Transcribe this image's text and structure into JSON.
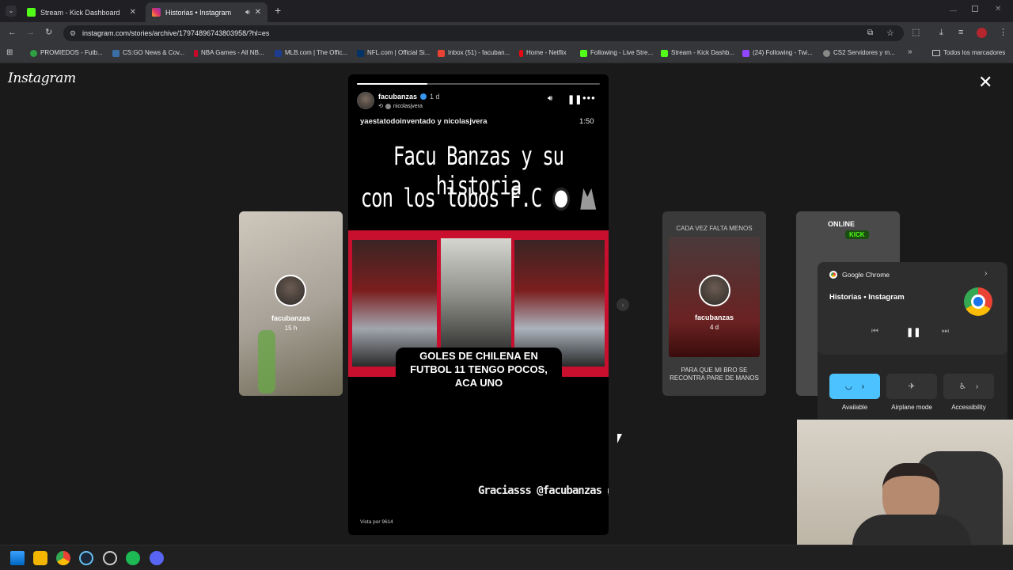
{
  "browser": {
    "tabs": [
      {
        "title": "Stream - Kick Dashboard",
        "favicon_color": "#53fc18"
      },
      {
        "title": "Historias • Instagram",
        "favicon_color": "#e1306c"
      }
    ],
    "url": "instagram.com/stories/archive/17974896743803958/?hl=es",
    "bookmarks": [
      "PROMIEDOS - Futb...",
      "CS:GO News & Cov...",
      "NBA Games - All NB...",
      "MLB.com | The Offic...",
      "NFL.com | Official Si...",
      "Inbox (51) - facuban...",
      "Home - Netflix",
      "Following - Live Stre...",
      "Stream - Kick Dashb...",
      "(24) Following - Twi...",
      "CS2 Servidores y m..."
    ],
    "bookmarks_folder": "Todos los marcadores"
  },
  "instagram": {
    "logo": "Instagram",
    "story": {
      "username": "facubanzas",
      "time": "1 d",
      "reposted_from": "nicolasjvera",
      "collab_line": "yaestatodoinventado y nicolasjvera",
      "duration": "1:50",
      "headline_line1": "Facu Banzas y su historia",
      "headline_line2": "con los lobos F.C",
      "caption": "GOLES DE CHILENA EN FUTBOL 11 TENGO POCOS, ACA UNO",
      "thanks": "Graciasss @facubanzas",
      "viewed_by": "Vista por 9614",
      "progress": 0.29
    },
    "prev_card": {
      "username": "facubanzas",
      "time": "15 h"
    },
    "next_card": {
      "top_text": "CADA VEZ FALTA MENOS",
      "username": "facubanzas",
      "time": "4 d",
      "bottom_text": "PARA QUE MI BRO SE RECONTRA PARE DE MANOS"
    },
    "far_card": {
      "online": "ONLINE",
      "kick": "KICK"
    }
  },
  "quick_settings": {
    "app": "Google Chrome",
    "media_title": "Historias • Instagram",
    "wifi_label": "Available",
    "airplane_label": "Airplane mode",
    "accessibility_label": "Accessibility"
  },
  "colors": {
    "accent": "#4cc2ff",
    "kick_green": "#53fc18",
    "story_red": "#c8102e"
  }
}
